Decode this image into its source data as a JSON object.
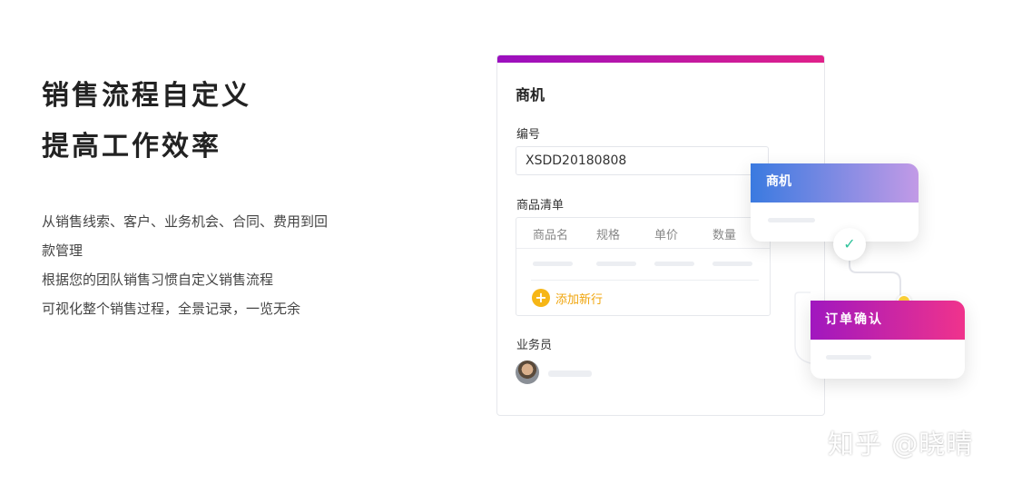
{
  "hero": {
    "title_line1": "销售流程自定义",
    "title_line2": "提高工作效率",
    "desc": [
      "从销售线索、客户、业务机会、合同、费用到回",
      "款管理",
      "根据您的团队销售习惯自定义销售流程",
      "可视化整个销售过程，全景记录，一览无余"
    ]
  },
  "card": {
    "title": "商机",
    "number_label": "编号",
    "number_value": "XSDD20180808",
    "goods_label": "商品清单",
    "goods_columns": [
      "商品名",
      "规格",
      "单价",
      "数量"
    ],
    "add_label": "添加新行",
    "sales_label": "业务员"
  },
  "flow": {
    "step1": "商机",
    "step2": "订单确认"
  },
  "watermark": "知乎 @晓晴",
  "colors": {
    "card_accent_start": "#9b0fbf",
    "card_accent_end": "#e0208a",
    "add_accent": "#f6b616",
    "check_color": "#2ec29a"
  },
  "icons": {
    "add": "plus-circle-icon",
    "check": "checkmark-icon"
  }
}
